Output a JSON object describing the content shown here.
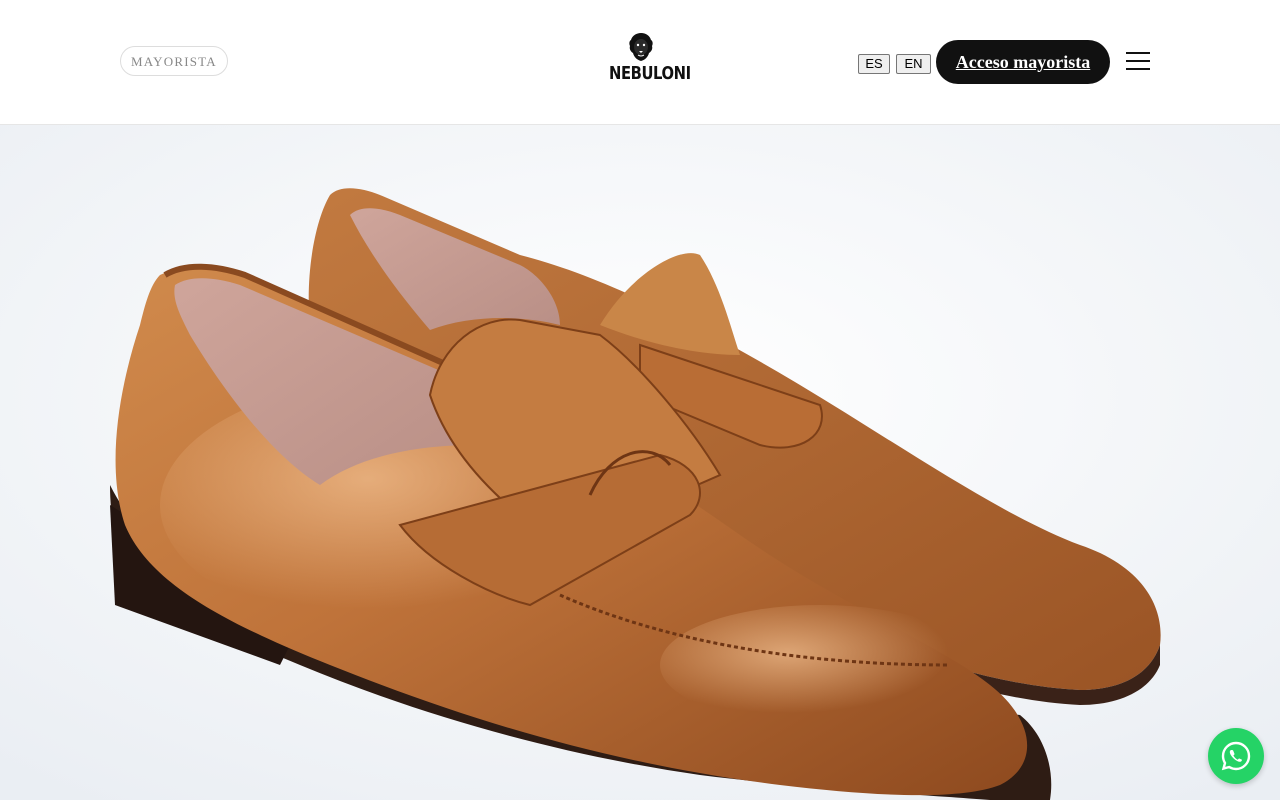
{
  "header": {
    "badge_label": "MAYORISTA",
    "logo_text": "NEBULONI",
    "languages": [
      "ES",
      "EN"
    ],
    "access_label": "Acceso mayorista"
  },
  "icons": {
    "logo": "lion-head-icon",
    "menu": "hamburger-menu-icon",
    "chat": "whatsapp-icon"
  },
  "hero": {
    "image_subject": "brown leather penny loafers"
  },
  "colors": {
    "primary": "#111111",
    "whatsapp": "#25D366",
    "leather": "#b86a33"
  }
}
